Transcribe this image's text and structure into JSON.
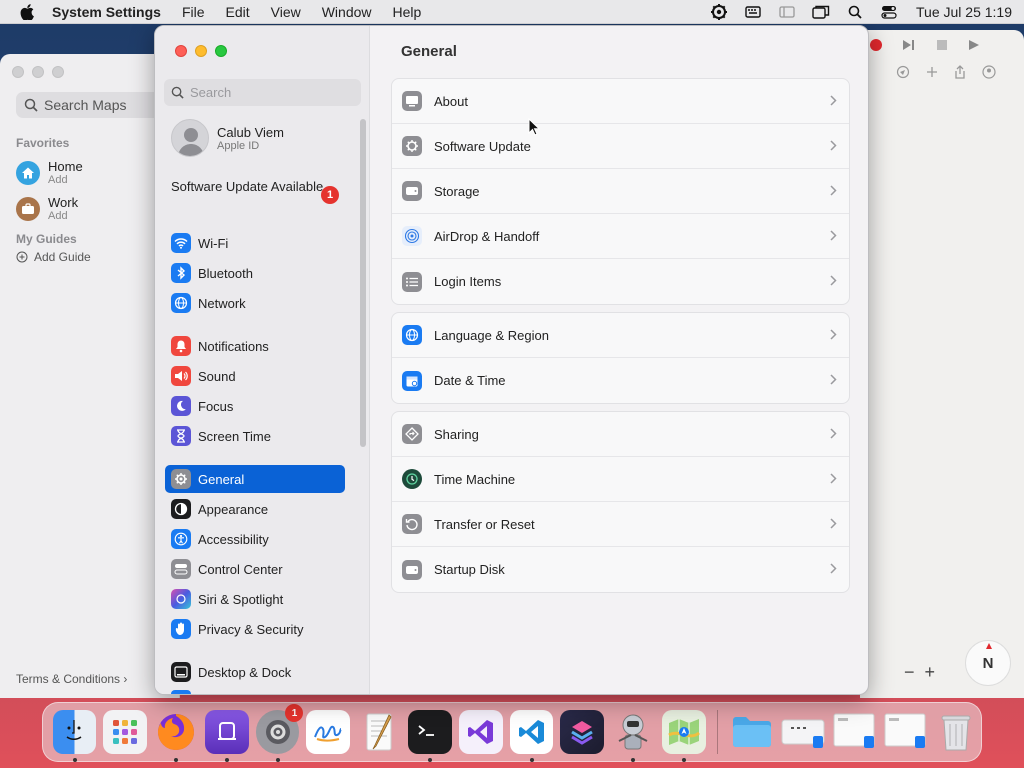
{
  "menubar": {
    "app_name": "System Settings",
    "menus": [
      "File",
      "Edit",
      "View",
      "Window",
      "Help"
    ],
    "clock": "Tue Jul 25  1:19"
  },
  "maps": {
    "search_placeholder": "Search Maps",
    "favorites_label": "Favorites",
    "favorites": [
      {
        "title": "Home",
        "subtitle": "Add"
      },
      {
        "title": "Work",
        "subtitle": "Add"
      }
    ],
    "guides_label": "My Guides",
    "add_guide": "Add Guide",
    "terms": "Terms & Conditions",
    "compass": "N"
  },
  "settings": {
    "search_placeholder": "Search",
    "account": {
      "name": "Calub Viem",
      "sub": "Apple ID"
    },
    "update_notice": "Software Update Available",
    "update_badge": "1",
    "sidebar": [
      {
        "label": "Wi-Fi",
        "icon": "wifi-icon",
        "color": "#1a7bf2"
      },
      {
        "label": "Bluetooth",
        "icon": "bluetooth-icon",
        "color": "#1a7bf2"
      },
      {
        "label": "Network",
        "icon": "globe-icon",
        "color": "#1a7bf2"
      },
      {
        "label": "Notifications",
        "icon": "bell-icon",
        "color": "#f0473e"
      },
      {
        "label": "Sound",
        "icon": "speaker-icon",
        "color": "#f0473e"
      },
      {
        "label": "Focus",
        "icon": "moon-icon",
        "color": "#5b55d6"
      },
      {
        "label": "Screen Time",
        "icon": "hourglass-icon",
        "color": "#5b55d6"
      },
      {
        "label": "General",
        "icon": "gear-icon",
        "color": "#8e8e93"
      },
      {
        "label": "Appearance",
        "icon": "appearance-icon",
        "color": "#1c1c1e"
      },
      {
        "label": "Accessibility",
        "icon": "accessibility-icon",
        "color": "#1a7bf2"
      },
      {
        "label": "Control Center",
        "icon": "control-center-icon",
        "color": "#8e8e93"
      },
      {
        "label": "Siri & Spotlight",
        "icon": "siri-icon",
        "color": "#7a4fd8"
      },
      {
        "label": "Privacy & Security",
        "icon": "hand-icon",
        "color": "#1a7bf2"
      },
      {
        "label": "Desktop & Dock",
        "icon": "dock-icon",
        "color": "#1c1c1e"
      }
    ],
    "selected": "General",
    "main_title": "General",
    "groups": [
      [
        {
          "label": "About",
          "icon": "monitor-icon"
        },
        {
          "label": "Software Update",
          "icon": "gear-badge-icon"
        },
        {
          "label": "Storage",
          "icon": "drive-icon"
        },
        {
          "label": "AirDrop & Handoff",
          "icon": "airdrop-icon"
        },
        {
          "label": "Login Items",
          "icon": "list-icon"
        }
      ],
      [
        {
          "label": "Language & Region",
          "icon": "globe-icon"
        },
        {
          "label": "Date & Time",
          "icon": "calendar-icon"
        }
      ],
      [
        {
          "label": "Sharing",
          "icon": "sharing-icon"
        },
        {
          "label": "Time Machine",
          "icon": "time-machine-icon"
        },
        {
          "label": "Transfer or Reset",
          "icon": "reset-icon"
        },
        {
          "label": "Startup Disk",
          "icon": "disk-icon"
        }
      ]
    ]
  },
  "dock": {
    "settings_badge": "1"
  }
}
